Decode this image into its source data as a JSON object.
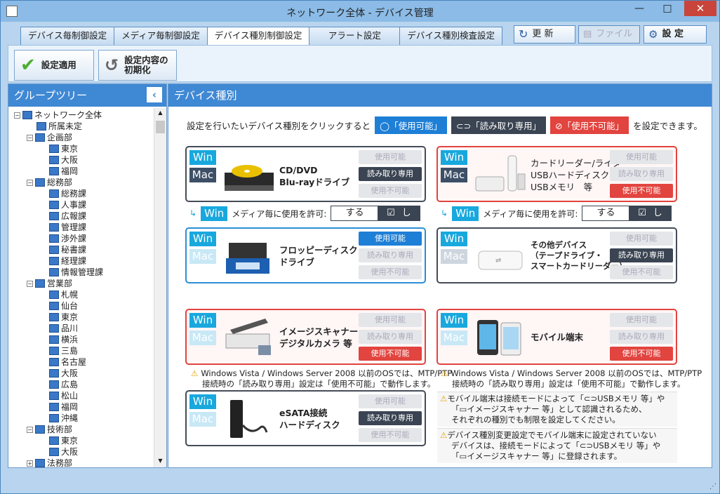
{
  "window": {
    "title": "ネットワーク全体 - デバイス管理",
    "minimize": "—",
    "maximize": "□",
    "close": "✕"
  },
  "tabs": [
    "デバイス毎制御設定",
    "メディア毎制御設定",
    "デバイス種別制御設定",
    "アラート設定",
    "デバイス種別検査設定"
  ],
  "right_buttons": {
    "refresh": "更 新",
    "file": "ファイル",
    "settings": "設 定"
  },
  "toolbar": {
    "apply": "設定適用",
    "reset_l1": "設定内容の",
    "reset_l2": "初期化"
  },
  "left": {
    "title": "グループツリー"
  },
  "tree": [
    {
      "label": "ネットワーク全体",
      "level": 0,
      "exp": "−"
    },
    {
      "label": "所属未定",
      "level": 1
    },
    {
      "label": "企画部",
      "level": 1,
      "exp": "−"
    },
    {
      "label": "東京",
      "level": 2
    },
    {
      "label": "大阪",
      "level": 2
    },
    {
      "label": "福岡",
      "level": 2
    },
    {
      "label": "総務部",
      "level": 1,
      "exp": "−"
    },
    {
      "label": "総務課",
      "level": 2
    },
    {
      "label": "人事課",
      "level": 2
    },
    {
      "label": "広報課",
      "level": 2
    },
    {
      "label": "管理課",
      "level": 2
    },
    {
      "label": "渉外課",
      "level": 2
    },
    {
      "label": "秘書課",
      "level": 2
    },
    {
      "label": "経理課",
      "level": 2
    },
    {
      "label": "情報管理課",
      "level": 2
    },
    {
      "label": "営業部",
      "level": 1,
      "exp": "−"
    },
    {
      "label": "札幌",
      "level": 2
    },
    {
      "label": "仙台",
      "level": 2
    },
    {
      "label": "東京",
      "level": 2
    },
    {
      "label": "品川",
      "level": 2
    },
    {
      "label": "横浜",
      "level": 2
    },
    {
      "label": "三島",
      "level": 2
    },
    {
      "label": "名古屋",
      "level": 2
    },
    {
      "label": "大阪",
      "level": 2
    },
    {
      "label": "広島",
      "level": 2
    },
    {
      "label": "松山",
      "level": 2
    },
    {
      "label": "福岡",
      "level": 2
    },
    {
      "label": "沖縄",
      "level": 2
    },
    {
      "label": "技術部",
      "level": 1,
      "exp": "−"
    },
    {
      "label": "東京",
      "level": 2
    },
    {
      "label": "大阪",
      "level": 2
    },
    {
      "label": "法務部",
      "level": 1,
      "exp": "+"
    }
  ],
  "right": {
    "title": "デバイス種別",
    "intro_pre": "設定を行いたいデバイス種別をクリックすると",
    "chip_on": "「使用可能」",
    "chip_ro": "「読み取り専用」",
    "chip_off": "「使用不可能」",
    "intro_post": "を設定できます。"
  },
  "status": {
    "on": "使用可能",
    "ro": "読み取り専用",
    "off": "使用不可能"
  },
  "os": {
    "win": "Win",
    "mac": "Mac"
  },
  "devices": {
    "cd": {
      "l1": "CD/DVD",
      "l2": "Blu-rayドライブ"
    },
    "card": {
      "l1": "カードリーダー/ライター",
      "l2": "USBハードディスク",
      "l3": "USBメモリ　等"
    },
    "fd": {
      "l1": "フロッピーディスク",
      "l2": "ドライブ"
    },
    "other": {
      "l1": "その他デバイス",
      "l2": "（テープドライブ・",
      "l3": "スマートカードリーダー）"
    },
    "scan": {
      "l1": "イメージスキャナー",
      "l2": "デジタルカメラ 等"
    },
    "mobile": {
      "l1": "モバイル端末"
    },
    "esata": {
      "l1": "eSATA接続",
      "l2": "ハードディスク"
    }
  },
  "media": {
    "label": "メディア毎に使用を許可:",
    "yes": "する",
    "no": "しない"
  },
  "warn": {
    "l1": "Windows Vista / Windows Server 2008 以前のOSでは、MTP/PTP",
    "l2": "接続時の「読み取り専用」設定は「使用不可能」で動作します。"
  },
  "note1": {
    "l1": "モバイル端末は接続モードによって「",
    "usb": "USBメモリ 等」や",
    "l2": "「",
    "scan": "イメージスキャナー 等」として認識されるため、",
    "l3": "それぞれの種別でも制限を設定してください。"
  },
  "note2": {
    "l1": "デバイス種別変更設定でモバイル端末に設定されていない",
    "l2": "デバイスは、接続モードによって「",
    "usb": "USBメモリ 等」や",
    "l3": "「",
    "scan": "イメージスキャナー 等」に登録されます。"
  }
}
